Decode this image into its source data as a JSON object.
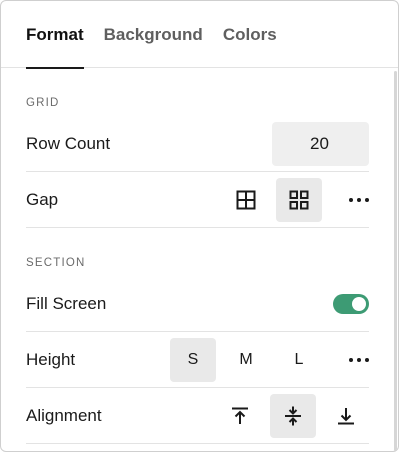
{
  "tabs": [
    {
      "label": "Format",
      "active": true
    },
    {
      "label": "Background",
      "active": false
    },
    {
      "label": "Colors",
      "active": false
    }
  ],
  "grid": {
    "section_label": "GRID",
    "row_count_label": "Row Count",
    "row_count_value": "20",
    "gap_label": "Gap",
    "gap_options": [
      "grid-none-icon",
      "grid-gap-icon"
    ],
    "gap_selected": 1
  },
  "section": {
    "section_label": "SECTION",
    "fill_screen_label": "Fill Screen",
    "fill_screen_on": true,
    "height_label": "Height",
    "height_options": [
      "S",
      "M",
      "L"
    ],
    "height_selected": "S",
    "alignment_label": "Alignment",
    "alignment_options": [
      "align-top-icon",
      "align-center-icon",
      "align-bottom-icon"
    ],
    "alignment_selected": 1
  },
  "colors": {
    "toggle_on": "#3d9b74",
    "selected_bg": "#e9e9e9",
    "input_bg": "#efefef"
  }
}
